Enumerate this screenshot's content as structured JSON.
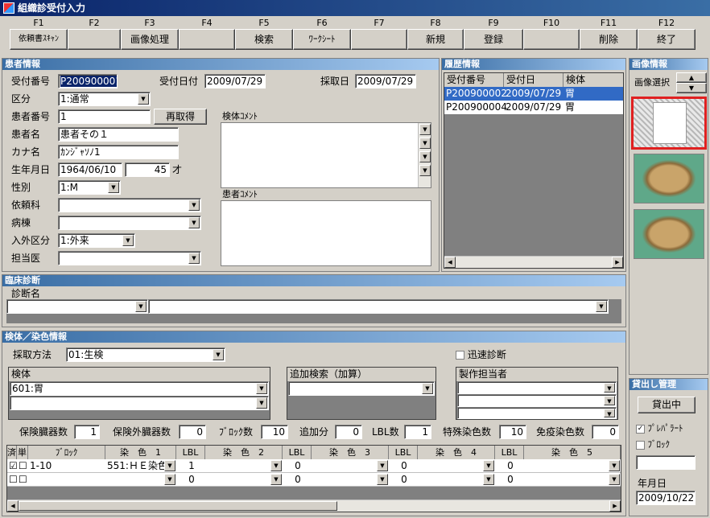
{
  "window": {
    "title": "組織診受付入力"
  },
  "fkeys": [
    {
      "key": "F1",
      "label": "依頼書ｽｷｬﾝ"
    },
    {
      "key": "F2",
      "label": ""
    },
    {
      "key": "F3",
      "label": "画像処理"
    },
    {
      "key": "F4",
      "label": ""
    },
    {
      "key": "F5",
      "label": "検索"
    },
    {
      "key": "F6",
      "label": "ﾜｰｸｼｰﾄ"
    },
    {
      "key": "F7",
      "label": ""
    },
    {
      "key": "F8",
      "label": "新規"
    },
    {
      "key": "F9",
      "label": "登録"
    },
    {
      "key": "F10",
      "label": ""
    },
    {
      "key": "F11",
      "label": "削除"
    },
    {
      "key": "F12",
      "label": "終了"
    }
  ],
  "patient": {
    "section_title": "患者情報",
    "reception_no_label": "受付番号",
    "reception_no": "P200900001",
    "reception_date_label": "受付日付",
    "reception_date": "2009/07/29",
    "collection_date_label": "採取日",
    "collection_date": "2009/07/29",
    "category_label": "区分",
    "category": "1:通常",
    "patient_no_label": "患者番号",
    "patient_no": "1",
    "reacquire_label": "再取得",
    "name_label": "患者名",
    "name": "患者その１",
    "kana_label": "カナ名",
    "kana": "ｶﾝｼﾞｬｿﾉ1",
    "birth_label": "生年月日",
    "birth": "1964/06/10",
    "age": "45",
    "age_unit": "才",
    "sex_label": "性別",
    "sex": "1:M",
    "dept_label": "依頼科",
    "dept": "",
    "ward_label": "病棟",
    "ward": "",
    "inout_label": "入外区分",
    "inout": "1:外来",
    "doctor_label": "担当医",
    "doctor": "",
    "specimen_comment_label": "検体ｺﾒﾝﾄ",
    "patient_comment_label": "患者ｺﾒﾝﾄ"
  },
  "history": {
    "section_title": "履歴情報",
    "headers": [
      "受付番号",
      "受付日",
      "検体"
    ],
    "rows": [
      [
        "P200900002",
        "2009/07/29",
        "胃"
      ],
      [
        "P200900004",
        "2009/07/29",
        "胃"
      ]
    ]
  },
  "image": {
    "section_title": "画像情報",
    "select_label": "画像選択",
    "selected_index": 0
  },
  "clinical": {
    "section_title": "臨床診断",
    "diagnosis_label": "診断名"
  },
  "specimen": {
    "section_title": "検体／染色情報",
    "method_label": "採取方法",
    "method": "01:生検",
    "rapid_label": "迅速診断",
    "specimen_label": "検体",
    "specimen_value": "601:胃",
    "additional_label": "追加検索（加算）",
    "producer_label": "製作担当者",
    "insured_label": "保険臓器数",
    "insured": "1",
    "uninsured_label": "保険外臓器数",
    "uninsured": "0",
    "block_count_label": "ﾌﾞﾛｯｸ数",
    "block_count": "10",
    "addition_label": "追加分",
    "addition": "0",
    "lbl_label": "LBL数",
    "lbl": "1",
    "special_label": "特殊染色数",
    "special": "10",
    "immuno_label": "免疫染色数",
    "immuno": "0",
    "grid_headers": [
      "済",
      "単",
      "ﾌﾞﾛｯｸ",
      "染　色　1",
      "LBL",
      "染　色　2",
      "LBL",
      "染　色　3",
      "LBL",
      "染　色　4",
      "LBL",
      "染　色　5"
    ],
    "grid_rows": [
      {
        "done": true,
        "single": false,
        "block": "1-10",
        "stain1": "551:ＨＥ染色",
        "lbl1": "1",
        "lbl2": "0",
        "lbl3": "0",
        "lbl4": "0"
      },
      {
        "done": false,
        "single": false,
        "block": "",
        "stain1": "",
        "lbl1": "0",
        "lbl2": "0",
        "lbl3": "0",
        "lbl4": "0"
      }
    ]
  },
  "lending": {
    "section_title": "貸出し管理",
    "lending_button": "貸出中",
    "preparat_label": "ﾌﾟﾚﾊﾟﾗｰﾄ",
    "preparat_checked": true,
    "block_label": "ﾌﾞﾛｯｸ",
    "block_checked": false,
    "date_label": "年月日",
    "date": "2009/10/22"
  }
}
